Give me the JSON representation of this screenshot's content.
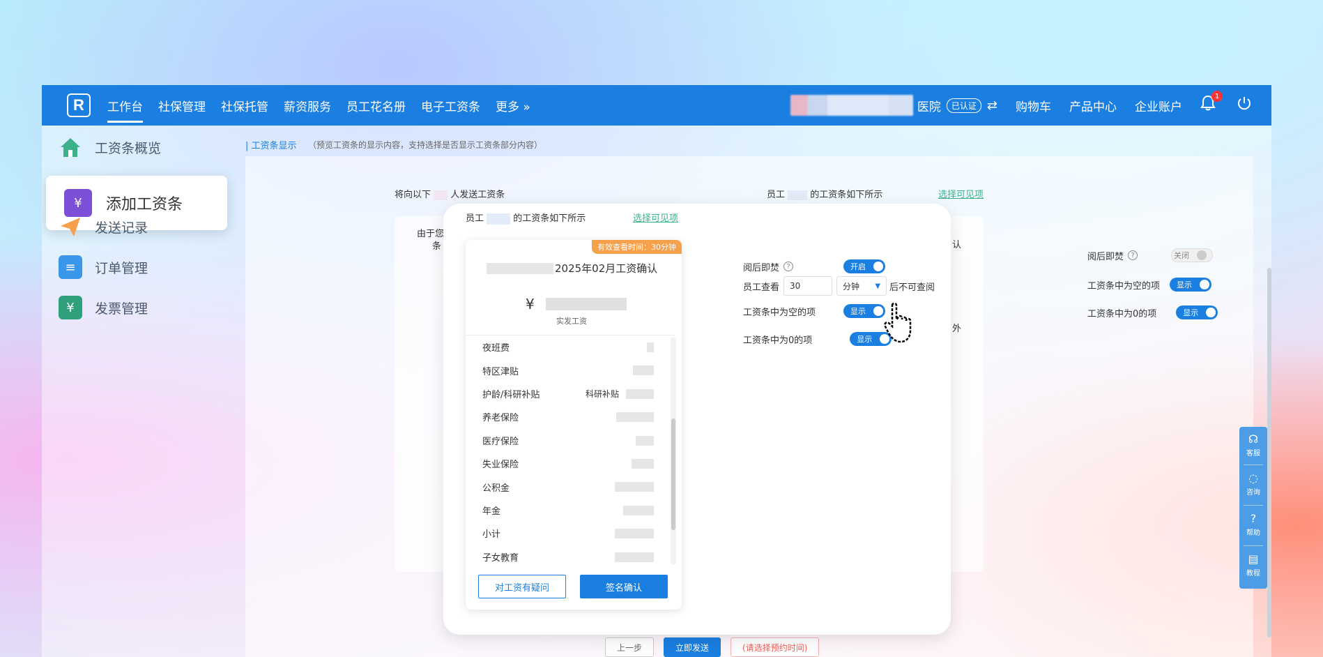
{
  "nav": {
    "items": [
      "工作台",
      "社保管理",
      "社保托管",
      "薪资服务",
      "员工花名册",
      "电子工资条",
      "更多 »"
    ],
    "org_name": "医院",
    "verified": "已认证",
    "links": [
      "购物车",
      "产品中心",
      "企业账户"
    ],
    "badge_count": "1"
  },
  "sidebar": {
    "items": [
      "工资条概览",
      "添加工资条",
      "发送记录",
      "订单管理",
      "发票管理"
    ]
  },
  "main": {
    "crumb": "工资条显示",
    "crumb_note": "（预览工资条的显示内容，支持选择是否显示工资条部分内容）",
    "send_to_prefix": "将向以下",
    "send_to_suffix": "人发送工资条",
    "employee_prefix": "员工",
    "employee_suffix": "的工资条如下所示",
    "select_visible": "选择可见项",
    "bg_fragment_1": "由于您",
    "bg_fragment_2": "条",
    "bg_fragment_3": "认",
    "bg_fragment_4": "外",
    "bg_settings": {
      "burn_label": "阅后即焚",
      "burn_state": "关闭",
      "empty_label": "工资条中为空的项",
      "empty_state": "显示",
      "zero_label": "工资条中为0的项",
      "zero_state": "显示"
    },
    "bottom": {
      "prev": "上一步",
      "send": "立即发送",
      "schedule": "(请选择预约时间)"
    }
  },
  "modal": {
    "employee_prefix": "员工",
    "employee_suffix": "的工资条如下所示",
    "select_visible": "选择可见项",
    "timer": "有效查看时间：30分钟",
    "slip_title": "2025年02月工资确认",
    "currency": "¥",
    "amount_label": "实发工资",
    "rows": [
      {
        "label": "夜班费",
        "extra": ""
      },
      {
        "label": "特区津贴",
        "extra": ""
      },
      {
        "label": "护龄/科研补贴",
        "extra": "科研补贴"
      },
      {
        "label": "养老保险",
        "extra": ""
      },
      {
        "label": "医疗保险",
        "extra": ""
      },
      {
        "label": "失业保险",
        "extra": ""
      },
      {
        "label": "公积金",
        "extra": ""
      },
      {
        "label": "年金",
        "extra": ""
      },
      {
        "label": "小计",
        "extra": ""
      },
      {
        "label": "子女教育",
        "extra": ""
      }
    ],
    "question_button": "对工资有疑问",
    "sign_button": "签名确认",
    "settings": {
      "burn_label": "阅后即焚",
      "burn_state": "开启",
      "view_label": "员工查看",
      "view_value": "30",
      "view_unit": "分钟",
      "view_suffix": "后不可查阅",
      "empty_label": "工资条中为空的项",
      "empty_state": "显示",
      "zero_label": "工资条中为0的项",
      "zero_state": "显示"
    }
  },
  "float_bar": [
    "客服",
    "咨询",
    "帮助",
    "教程"
  ],
  "colors": {
    "primary": "#1a7fe0",
    "accent_green": "#3bb08b",
    "timer_orange": "#f5a04a"
  }
}
